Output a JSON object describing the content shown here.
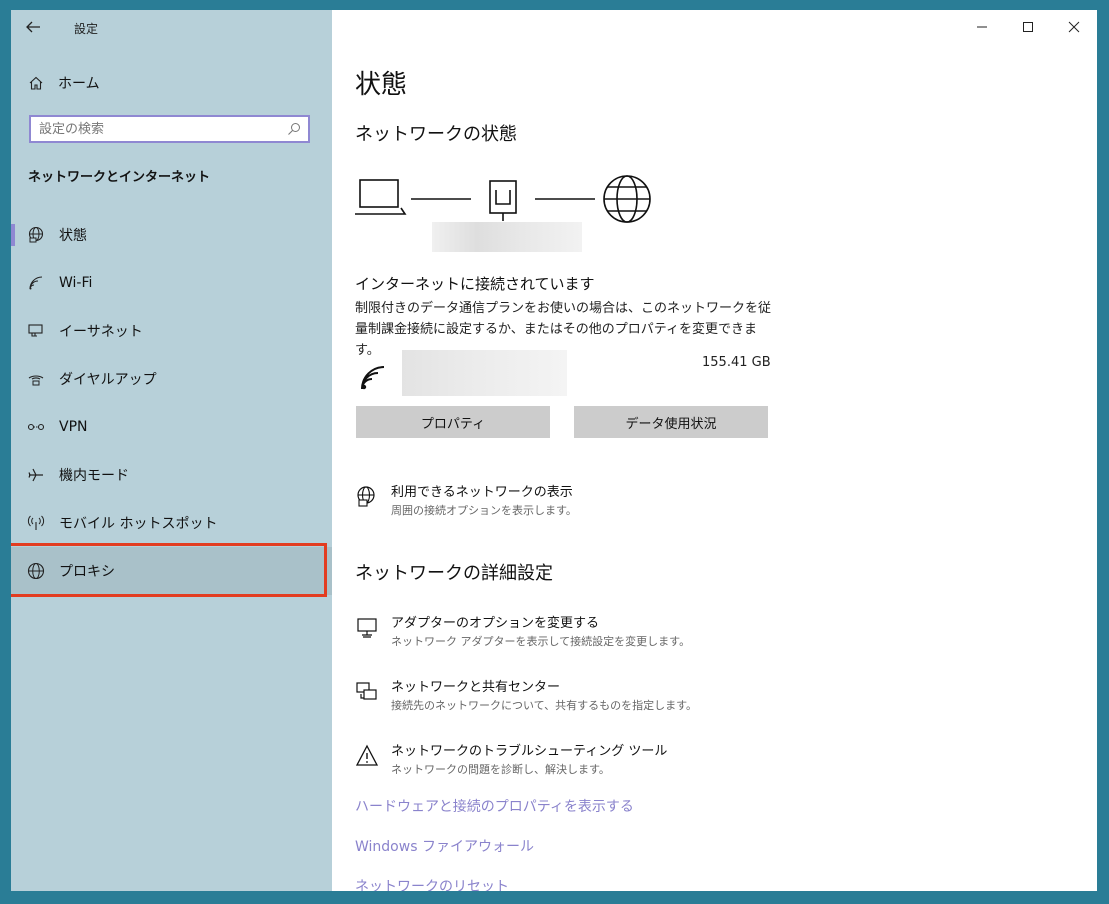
{
  "titlebar": {
    "app_title": "設定"
  },
  "sidebar": {
    "home_label": "ホーム",
    "search_placeholder": "設定の検索",
    "section_title": "ネットワークとインターネット",
    "items": [
      {
        "label": "状態",
        "icon": "globe-status-icon"
      },
      {
        "label": "Wi-Fi",
        "icon": "wifi-icon"
      },
      {
        "label": "イーサネット",
        "icon": "ethernet-icon"
      },
      {
        "label": "ダイヤルアップ",
        "icon": "dialup-icon"
      },
      {
        "label": "VPN",
        "icon": "vpn-icon"
      },
      {
        "label": "機内モード",
        "icon": "airplane-icon"
      },
      {
        "label": "モバイル ホットスポット",
        "icon": "hotspot-icon"
      },
      {
        "label": "プロキシ",
        "icon": "globe-icon"
      }
    ],
    "active_item": "状態",
    "highlighted_item": "プロキシ"
  },
  "main": {
    "page_title": "状態",
    "network_status_heading": "ネットワークの状態",
    "connection_status": "インターネットに接続されています",
    "connection_desc": "制限付きのデータ通信プランをお使いの場合は、このネットワークを従量制課金接続に設定するか、またはその他のプロパティを変更できます。",
    "data_usage": "155.41 GB",
    "buttons": {
      "properties": "プロパティ",
      "data_usage": "データ使用状況"
    },
    "show_networks": {
      "title": "利用できるネットワークの表示",
      "subtitle": "周囲の接続オプションを表示します。"
    },
    "advanced_heading": "ネットワークの詳細設定",
    "advanced_items": [
      {
        "title": "アダプターのオプションを変更する",
        "subtitle": "ネットワーク アダプターを表示して接続設定を変更します。"
      },
      {
        "title": "ネットワークと共有センター",
        "subtitle": "接続先のネットワークについて、共有するものを指定します。"
      },
      {
        "title": "ネットワークのトラブルシューティング ツール",
        "subtitle": "ネットワークの問題を診断し、解決します。"
      }
    ],
    "links": [
      "ハードウェアと接続のプロパティを表示する",
      "Windows ファイアウォール",
      "ネットワークのリセット"
    ]
  },
  "colors": {
    "sidebar_bg": "#b7d0d9",
    "accent": "#8f88d2",
    "link": "#8a83cc",
    "highlight_border": "#e33c20",
    "desktop_bg": "#2a7d96"
  }
}
